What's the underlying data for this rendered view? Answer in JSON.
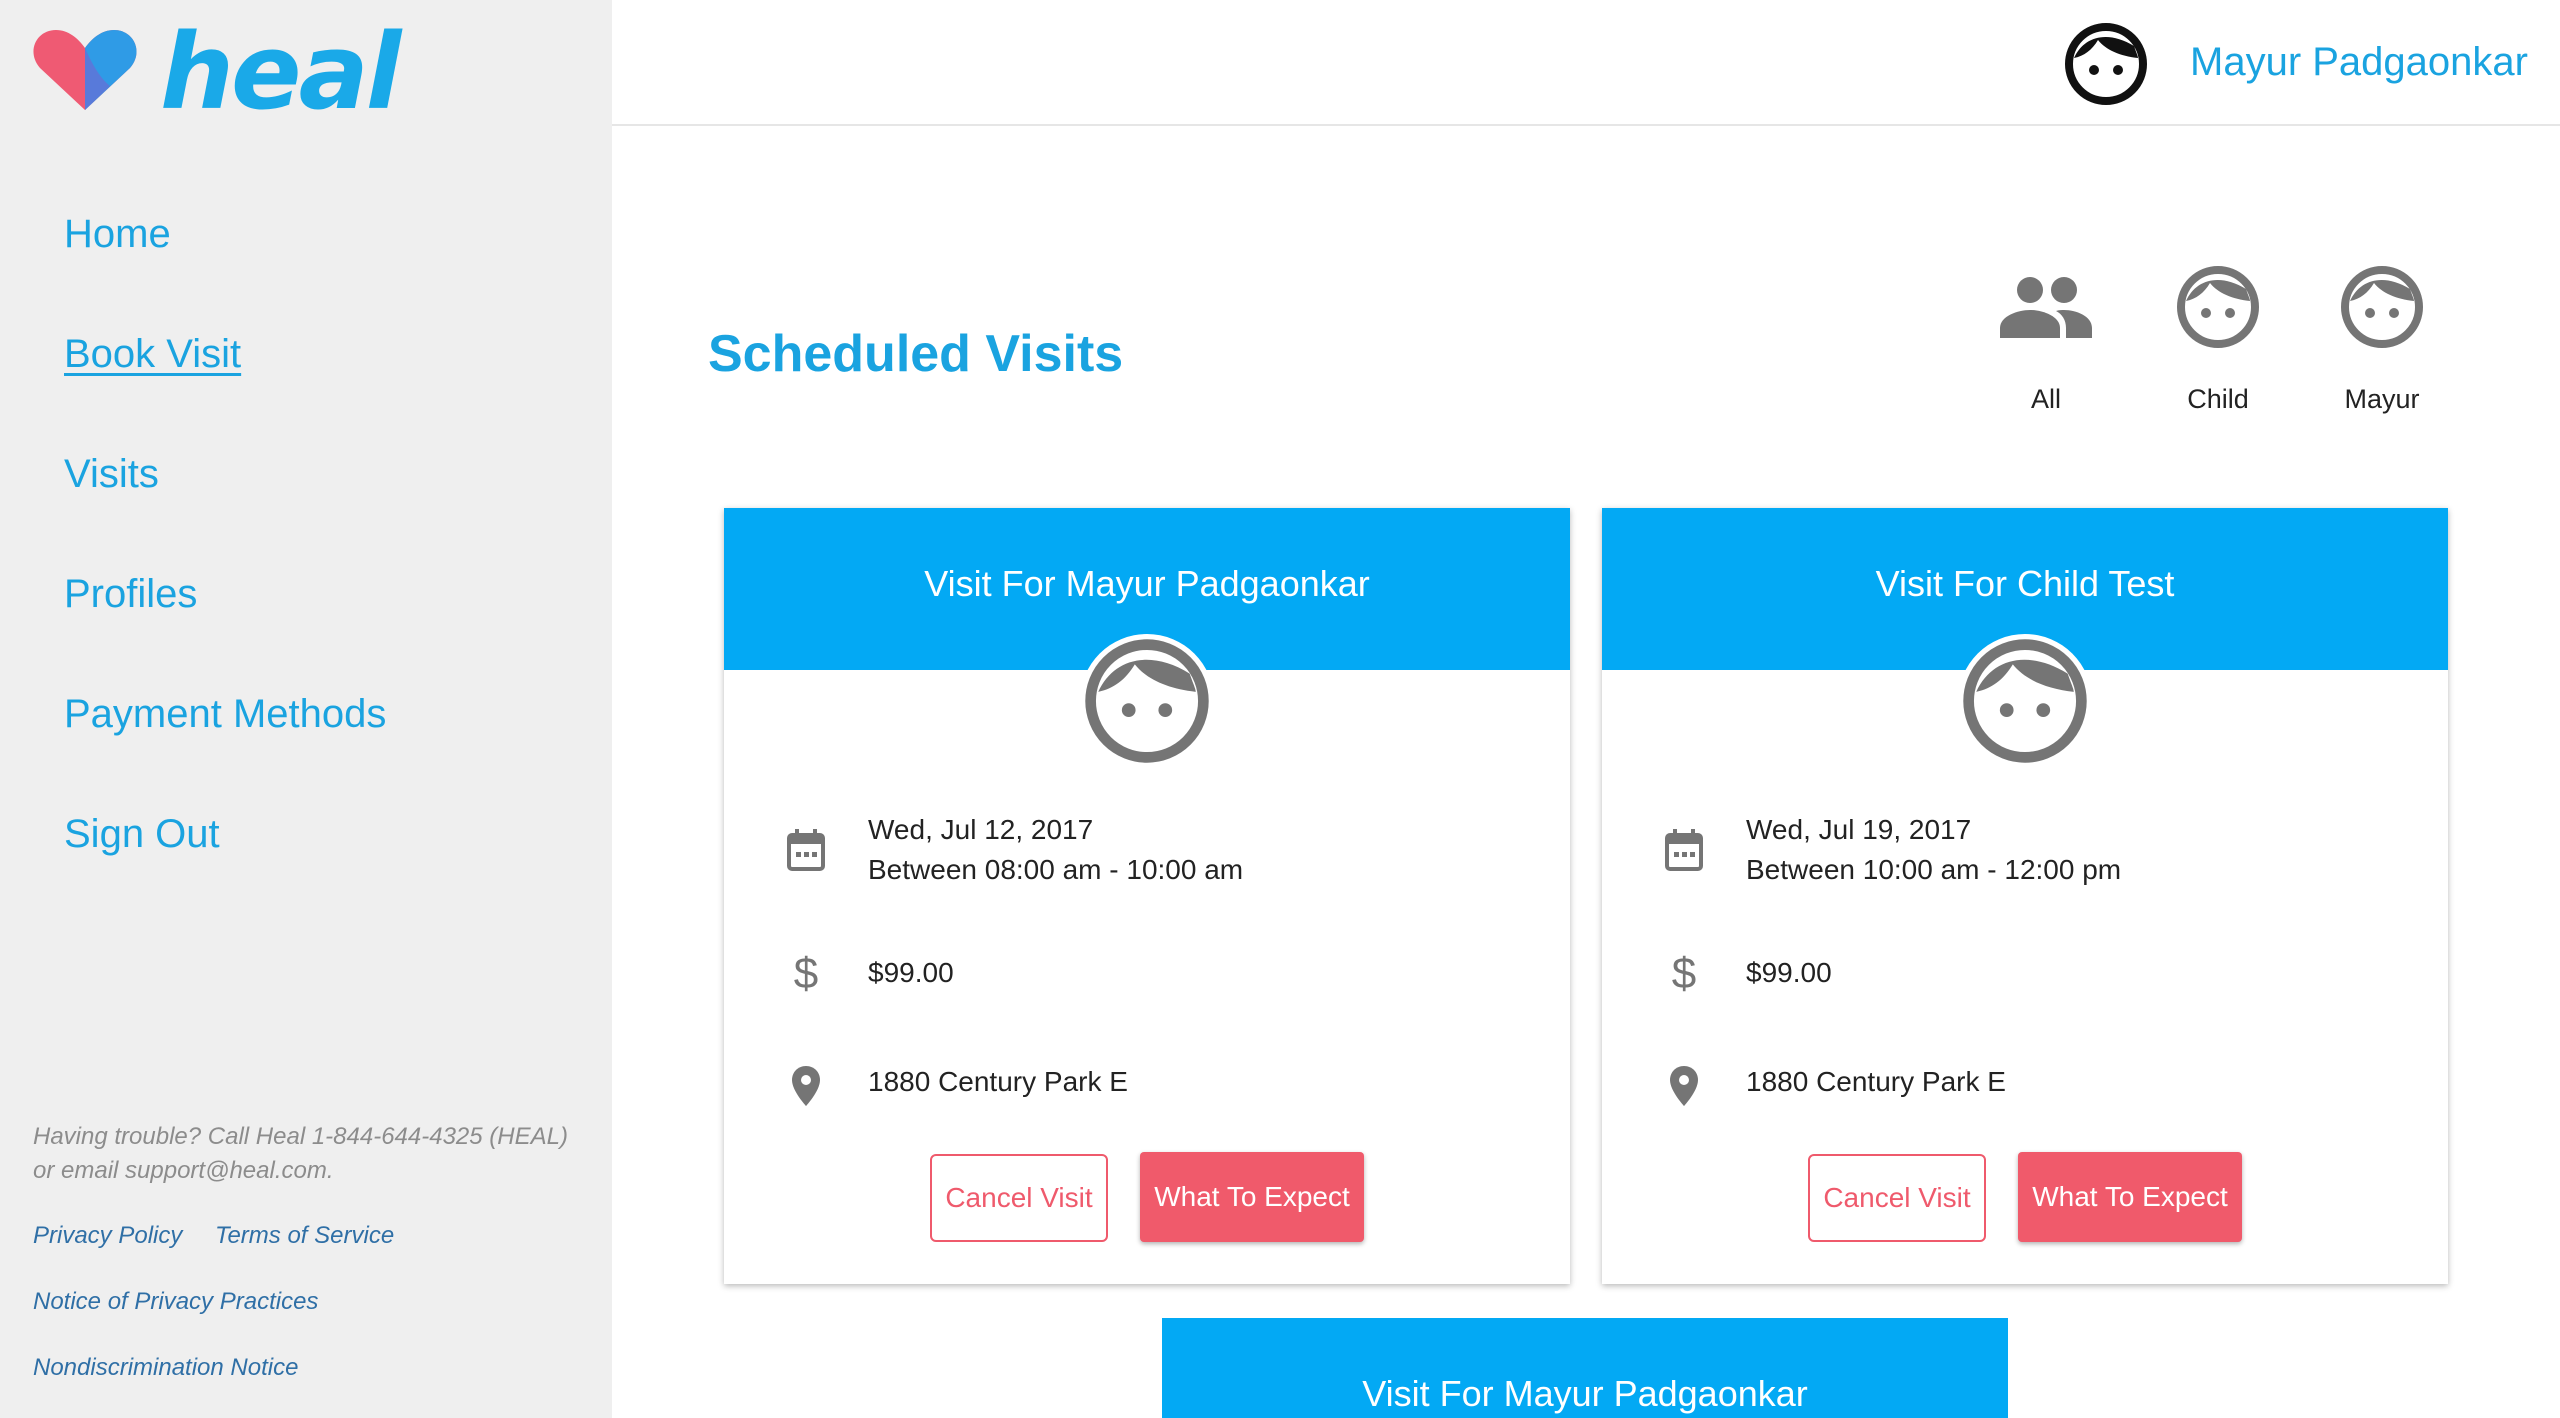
{
  "brand": {
    "name": "heal",
    "primary_color": "#1aa3e0",
    "header_color": "#03a9f4",
    "accent_color": "#f05a6b"
  },
  "sidebar": {
    "items": [
      {
        "label": "Home"
      },
      {
        "label": "Book Visit",
        "active": true
      },
      {
        "label": "Visits"
      },
      {
        "label": "Profiles"
      },
      {
        "label": "Payment Methods"
      },
      {
        "label": "Sign Out"
      }
    ],
    "help_line1": "Having trouble? Call Heal 1-844-644-4325 (HEAL)",
    "help_line2": "or email support@heal.com.",
    "footer_links": {
      "privacy_policy": "Privacy Policy",
      "terms": "Terms of Service",
      "privacy_practices": "Notice of Privacy Practices",
      "nondiscrimination": "Nondiscrimination Notice"
    }
  },
  "header": {
    "user_name": "Mayur Padgaonkar",
    "avatar_icon": "face-icon"
  },
  "main": {
    "title": "Scheduled Visits",
    "filters": [
      {
        "label": "All",
        "icon": "group-icon"
      },
      {
        "label": "Child",
        "icon": "face-icon"
      },
      {
        "label": "Mayur",
        "icon": "face-icon"
      }
    ],
    "visits": [
      {
        "title": "Visit For Mayur Padgaonkar",
        "date": "Wed, Jul 12, 2017",
        "time": "Between 08:00 am - 10:00 am",
        "price": "$99.00",
        "address": "1880 Century Park E",
        "cancel_label": "Cancel Visit",
        "expect_label": "What To Expect"
      },
      {
        "title": "Visit For Child Test",
        "date": "Wed, Jul 19, 2017",
        "time": "Between 10:00 am - 12:00 pm",
        "price": "$99.00",
        "address": "1880 Century Park E",
        "cancel_label": "Cancel Visit",
        "expect_label": "What To Expect"
      },
      {
        "title": "Visit For Mayur Padgaonkar"
      }
    ]
  }
}
